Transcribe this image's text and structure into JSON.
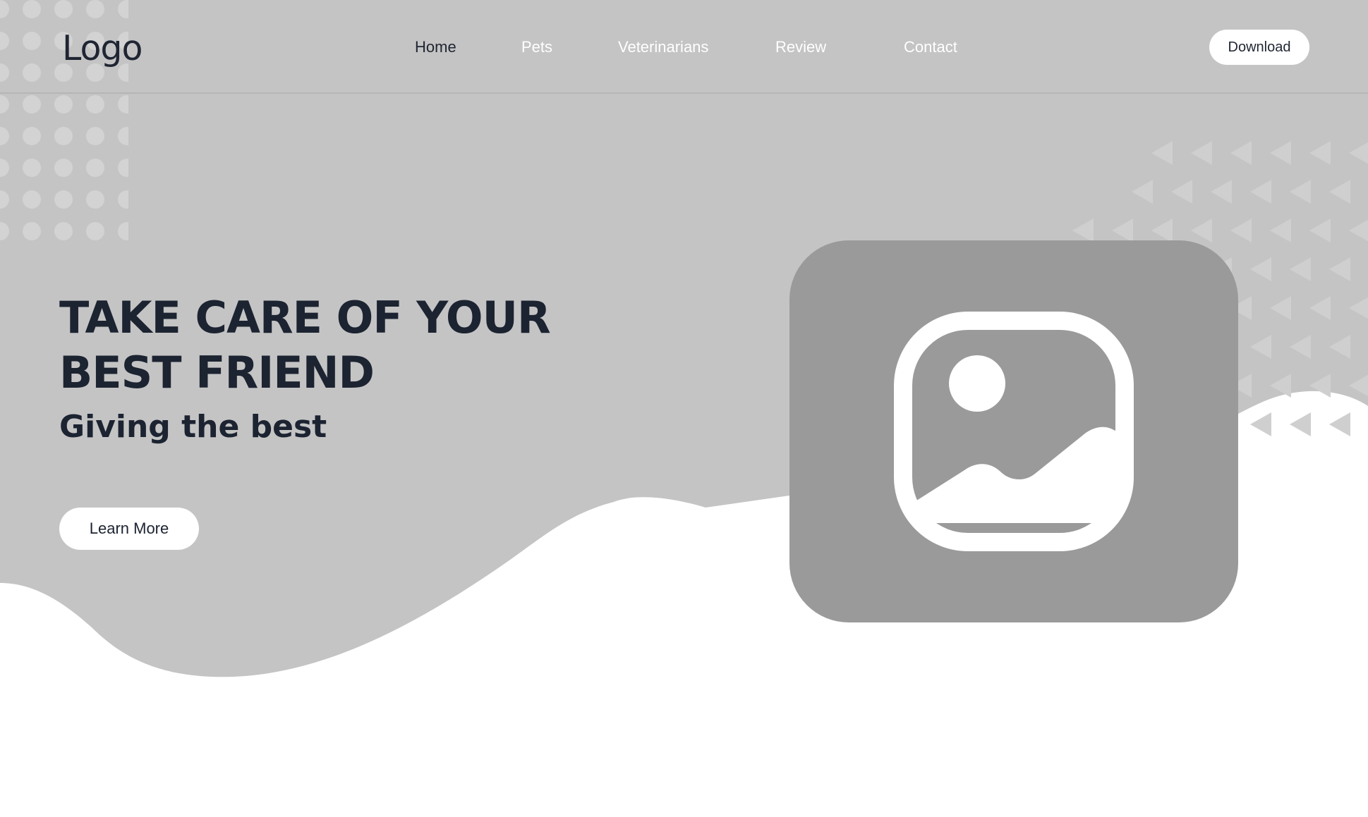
{
  "header": {
    "logo": "Logo",
    "nav": [
      {
        "label": "Home",
        "active": true
      },
      {
        "label": "Pets",
        "active": false
      },
      {
        "label": "Veterinarians",
        "active": false
      },
      {
        "label": "Review",
        "active": false
      },
      {
        "label": "Contact",
        "active": false
      }
    ],
    "download_label": "Download"
  },
  "hero": {
    "headline_line1": "TAKE CARE OF YOUR",
    "headline_line2": "BEST FRIEND",
    "subheadline": "Giving the best",
    "cta_label": "Learn More",
    "image_icon": "image-placeholder-icon"
  },
  "colors": {
    "background_gray": "#c4c4c4",
    "card_gray": "#9a9a9a",
    "text_dark": "#1c2331",
    "white": "#ffffff"
  }
}
